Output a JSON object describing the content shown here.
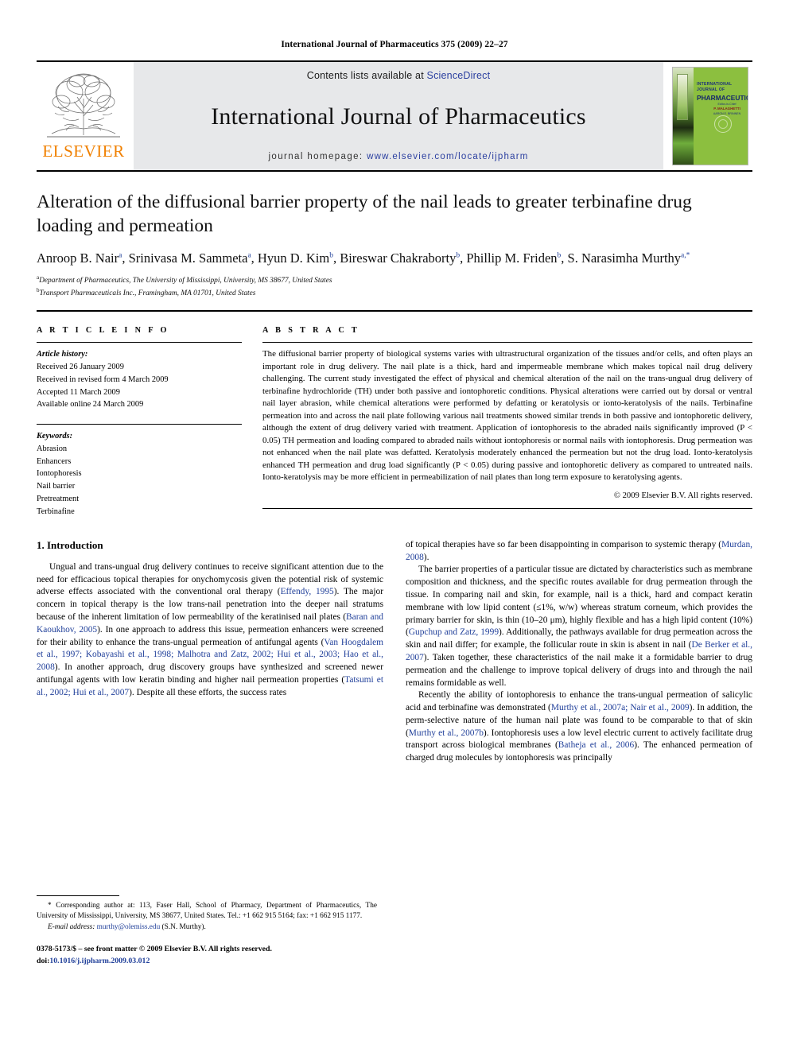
{
  "running_head": "International Journal of Pharmaceutics 375 (2009) 22–27",
  "masthead": {
    "contents_prefix": "Contents lists available at ",
    "sciencedirect": "ScienceDirect",
    "journal_name": "International Journal of Pharmaceutics",
    "homepage_prefix": "journal homepage: ",
    "homepage_url": "www.elsevier.com/locate/ijpharm",
    "publisher": "ELSEVIER",
    "cover": {
      "line1": "INTERNATIONAL JOURNAL OF",
      "line2": "PHARMACEUTICS",
      "sub1": "Editor-in-Chief",
      "sub2": "P. MALAGHETTI",
      "sub3": "AARON E. BRINNEN"
    },
    "accent_blue": "#2b3fa0",
    "accent_orange": "#F08000"
  },
  "article": {
    "title": "Alteration of the diffusional barrier property of the nail leads to greater terbinafine drug loading and permeation",
    "authors": [
      {
        "name": "Anroop B. Nair",
        "sup": "a",
        "sep": ", "
      },
      {
        "name": "Srinivasa M. Sammeta",
        "sup": "a",
        "sep": ", "
      },
      {
        "name": "Hyun D. Kim",
        "sup": "b",
        "sep": ", "
      },
      {
        "name": "Bireswar Chakraborty",
        "sup": "b",
        "sep": ", "
      },
      {
        "name": "Phillip M. Friden",
        "sup": "b",
        "sep": ", "
      },
      {
        "name": "S. Narasimha Murthy",
        "sup": "a,*",
        "sep": ""
      }
    ],
    "affiliations": [
      {
        "mark": "a",
        "text": "Department of Pharmaceutics, The University of Mississippi, University, MS 38677, United States"
      },
      {
        "mark": "b",
        "text": "Transport Pharmaceuticals Inc., Framingham, MA 01701, United States"
      }
    ]
  },
  "article_info": {
    "heading": "A R T I C L E   I N F O",
    "history_label": "Article history:",
    "history": [
      "Received 26 January 2009",
      "Received in revised form 4 March 2009",
      "Accepted 11 March 2009",
      "Available online 24 March 2009"
    ],
    "keywords_label": "Keywords:",
    "keywords": [
      "Abrasion",
      "Enhancers",
      "Iontophoresis",
      "Nail barrier",
      "Pretreatment",
      "Terbinafine"
    ]
  },
  "abstract": {
    "heading": "A B S T R A C T",
    "text": "The diffusional barrier property of biological systems varies with ultrastructural organization of the tissues and/or cells, and often plays an important role in drug delivery. The nail plate is a thick, hard and impermeable membrane which makes topical nail drug delivery challenging. The current study investigated the effect of physical and chemical alteration of the nail on the trans-ungual drug delivery of terbinafine hydrochloride (TH) under both passive and iontophoretic conditions. Physical alterations were carried out by dorsal or ventral nail layer abrasion, while chemical alterations were performed by defatting or keratolysis or ionto-keratolysis of the nails. Terbinafine permeation into and across the nail plate following various nail treatments showed similar trends in both passive and iontophoretic delivery, although the extent of drug delivery varied with treatment. Application of iontophoresis to the abraded nails significantly improved (P < 0.05) TH permeation and loading compared to abraded nails without iontophoresis or normal nails with iontophoresis. Drug permeation was not enhanced when the nail plate was defatted. Keratolysis moderately enhanced the permeation but not the drug load. Ionto-keratolysis enhanced TH permeation and drug load significantly (P < 0.05) during passive and iontophoretic delivery as compared to untreated nails. Ionto-keratolysis may be more efficient in permeabilization of nail plates than long term exposure to keratolysing agents.",
    "copyright": "© 2009 Elsevier B.V. All rights reserved."
  },
  "introduction": {
    "heading": "1.  Introduction",
    "left_para_1_a": "Ungual and trans-ungual drug delivery continues to receive significant attention due to the need for efficacious topical therapies for onychomycosis given the potential risk of systemic adverse effects associated with the conventional oral therapy (",
    "left_cite_1": "Effendy, 1995",
    "left_para_1_b": "). The major concern in topical therapy is the low trans-nail penetration into the deeper nail stratums because of the inherent limitation of low permeability of the keratinised nail plates (",
    "left_cite_2": "Baran and Kaoukhov, 2005",
    "left_para_1_c": "). In one approach to address this issue, permeation enhancers were screened for their ability to enhance the trans-ungual permeation of antifungal agents (",
    "left_cite_3": "Van Hoogdalem et al., 1997; Kobayashi et al., 1998; Malhotra and Zatz, 2002; Hui et al., 2003; Hao et al., 2008",
    "left_para_1_d": "). In another approach, drug discovery groups have synthesized and screened newer antifungal agents with low keratin binding and higher nail permeation properties (",
    "left_cite_4": "Tatsumi et al., 2002; Hui et al., 2007",
    "left_para_1_e": "). Despite all these efforts, the success rates",
    "right_para_0_a": "of topical therapies have so far been disappointing in comparison to systemic therapy (",
    "right_cite_0": "Murdan, 2008",
    "right_para_0_b": ").",
    "right_para_1_a": "The barrier properties of a particular tissue are dictated by characteristics such as membrane composition and thickness, and the specific routes available for drug permeation through the tissue. In comparing nail and skin, for example, nail is a thick, hard and compact keratin membrane with low lipid content (≤1%, w/w) whereas stratum corneum, which provides the primary barrier for skin, is thin (10–20 μm), highly flexible and has a high lipid content (10%) (",
    "right_cite_1": "Gupchup and Zatz, 1999",
    "right_para_1_b": "). Additionally, the pathways available for drug permeation across the skin and nail differ; for example, the follicular route in skin is absent in nail (",
    "right_cite_2": "De Berker et al., 2007",
    "right_para_1_c": "). Taken together, these characteristics of the nail make it a formidable barrier to drug permeation and the challenge to improve topical delivery of drugs into and through the nail remains formidable as well.",
    "right_para_2_a": "Recently the ability of iontophoresis to enhance the trans-ungual permeation of salicylic acid and terbinafine was demonstrated (",
    "right_cite_3": "Murthy et al., 2007a; Nair et al., 2009",
    "right_para_2_b": "). In addition, the perm-selective nature of the human nail plate was found to be comparable to that of skin (",
    "right_cite_4": "Murthy et al., 2007b",
    "right_para_2_c": "). Iontophoresis uses a low level electric current to actively facilitate drug transport across biological membranes (",
    "right_cite_5": "Batheja et al., 2006",
    "right_para_2_d": "). The enhanced permeation of charged drug molecules by iontophoresis was principally"
  },
  "footnotes": {
    "corresponding_star": "*",
    "corresponding": "Corresponding author at: 113, Faser Hall, School of Pharmacy, Department of Pharmaceutics, The University of Mississippi, University, MS 38677, United States. Tel.: +1 662 915 5164; fax: +1 662 915 1177.",
    "email_label": "E-mail address:",
    "email": "murthy@olemiss.edu",
    "email_suffix": "(S.N. Murthy).",
    "issn_line": "0378-5173/$ – see front matter © 2009 Elsevier B.V. All rights reserved.",
    "doi_label": "doi:",
    "doi": "10.1016/j.ijpharm.2009.03.012"
  }
}
